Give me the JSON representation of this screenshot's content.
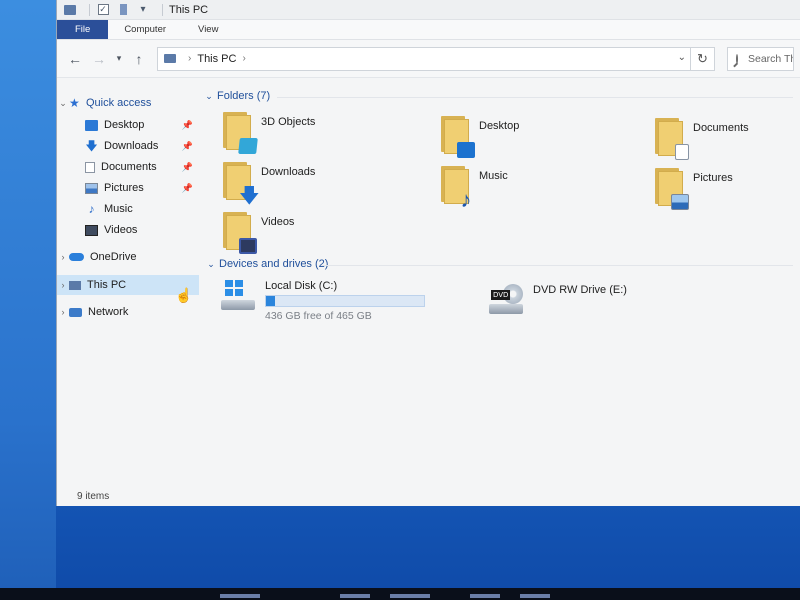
{
  "window": {
    "title": "This PC"
  },
  "quick_access_toolbar": {
    "icons": [
      "pc-icon",
      "properties-checkbox-icon",
      "new-folder-icon",
      "customize-dropdown-icon"
    ]
  },
  "ribbon": {
    "tabs": [
      "File",
      "Computer",
      "View"
    ],
    "active_tab": "File",
    "active_color": "#2b4f99"
  },
  "address": {
    "location": "This PC",
    "icons": [
      "back-arrow",
      "forward-arrow",
      "recent-dropdown",
      "up-arrow",
      "refresh"
    ]
  },
  "search": {
    "placeholder": "Search This PC",
    "visible_text": "Search Th"
  },
  "nav_pane": {
    "quick_access": {
      "label": "Quick access"
    },
    "items": [
      {
        "label": "Desktop",
        "pinned": true
      },
      {
        "label": "Downloads",
        "pinned": true
      },
      {
        "label": "Documents",
        "pinned": true
      },
      {
        "label": "Pictures",
        "pinned": true
      },
      {
        "label": "Music",
        "pinned": false
      },
      {
        "label": "Videos",
        "pinned": false
      }
    ],
    "onedrive": "OneDrive",
    "this_pc": "This PC",
    "network": "Network",
    "selected": "This PC",
    "selection_color": "#cde4f7"
  },
  "folders": {
    "header": "Folders (7)",
    "items": [
      "3D Objects",
      "Desktop",
      "Documents",
      "Downloads",
      "Music",
      "Pictures",
      "Videos"
    ]
  },
  "drives": {
    "header": "Devices and drives (2)",
    "items": [
      {
        "name": "Local Disk (C:)",
        "free_text": "436 GB free of 465 GB",
        "used_fraction": 0.06
      },
      {
        "name": "DVD RW Drive (E:)"
      }
    ],
    "bar_color": "#2b85dc"
  },
  "status": {
    "items_text": "9 items"
  },
  "accent_header_color": "#1f4f9b"
}
